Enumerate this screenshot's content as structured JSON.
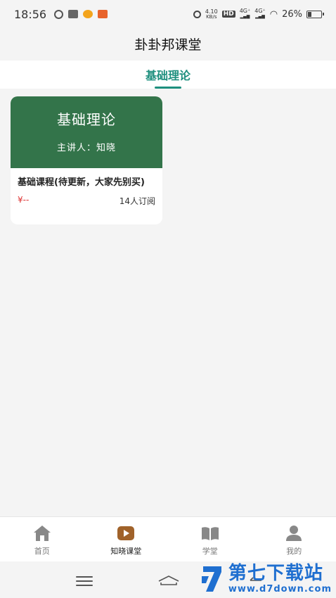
{
  "status_bar": {
    "time": "18:56",
    "net_speed_value": "4.10",
    "net_speed_unit": "KB/s",
    "hd_label": "HD",
    "signal1": "4G⁺",
    "signal2": "4G⁺",
    "battery_percent": "26%",
    "battery_level": 0.26
  },
  "header": {
    "title": "卦卦邦课堂"
  },
  "tabs": [
    {
      "label": "基础理论",
      "active": true
    }
  ],
  "courses": [
    {
      "cover_title": "基础理论",
      "cover_lecturer": "主讲人：知晓",
      "name": "基础课程(待更新，大家先别买)",
      "price": "¥--",
      "subscribers": "14人订阅",
      "cover_color": "#33744a"
    }
  ],
  "bottom_nav": [
    {
      "label": "首页",
      "icon": "home-icon",
      "active": false
    },
    {
      "label": "知晓课堂",
      "icon": "play-icon",
      "active": true
    },
    {
      "label": "学堂",
      "icon": "book-icon",
      "active": false
    },
    {
      "label": "我的",
      "icon": "user-icon",
      "active": false
    }
  ],
  "watermark": {
    "title": "第七下载站",
    "url": "www.d7down.com"
  },
  "colors": {
    "accent": "#1e8f7e",
    "price": "#dd3333",
    "play_icon": "#a0622a"
  }
}
